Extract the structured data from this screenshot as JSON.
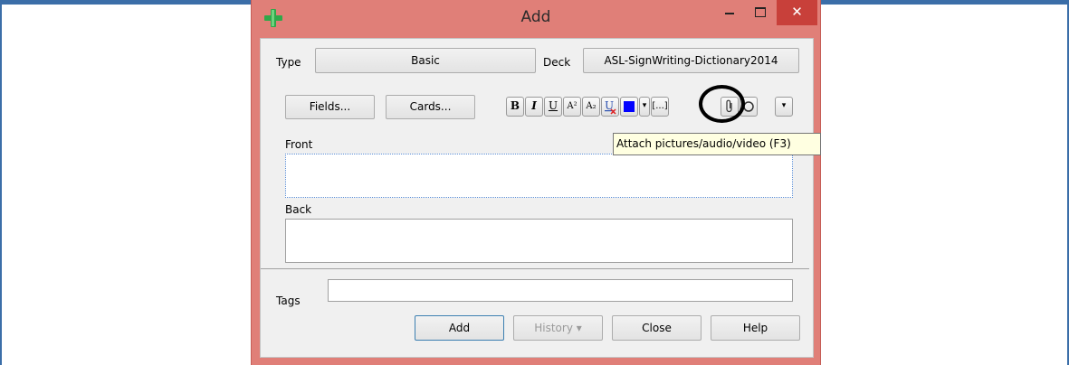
{
  "window": {
    "title": "Add"
  },
  "type_row": {
    "type_label": "Type",
    "type_value": "Basic",
    "deck_label": "Deck",
    "deck_value": "ASL-SignWriting-Dictionary2014"
  },
  "toolbar": {
    "fields_label": "Fields...",
    "cards_label": "Cards...",
    "bold": "B",
    "italic": "I",
    "underline": "U",
    "superscript": "A²",
    "subscript": "A₂",
    "dropdown": "▾",
    "cloze": "[...]"
  },
  "fields": {
    "front_label": "Front",
    "back_label": "Back"
  },
  "tags": {
    "label": "Tags",
    "value": ""
  },
  "actions": {
    "add_label": "Add",
    "history_label": "History ▾",
    "close_label": "Close",
    "help_label": "Help"
  },
  "tooltip": {
    "text": "Attach pictures/audio/video (F3)"
  },
  "colors": {
    "titlebar": "#e07f78",
    "close": "#c8403a",
    "text_color_swatch": "#0000ff"
  }
}
